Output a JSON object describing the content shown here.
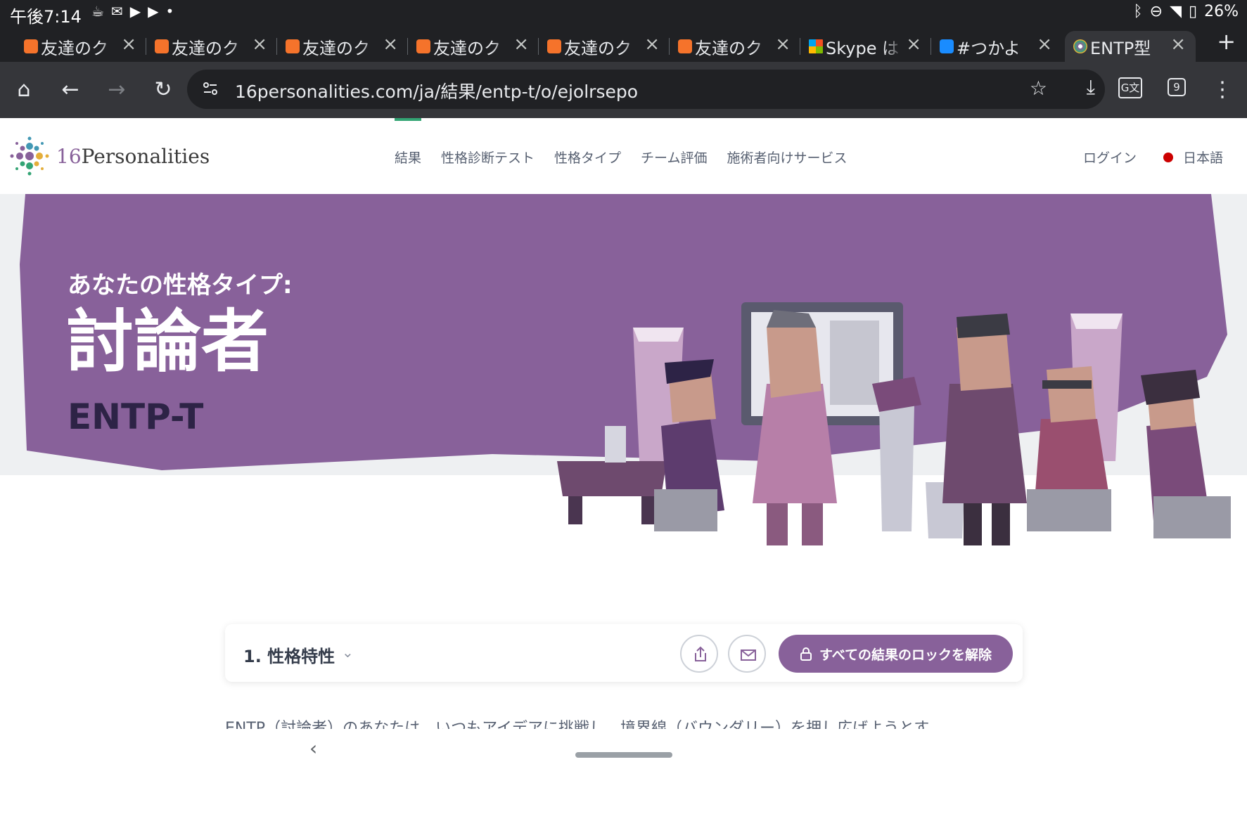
{
  "status_bar": {
    "time": "午後7:14",
    "battery": "26%"
  },
  "tabs": [
    {
      "title": "友達のク",
      "favicon_color": "#f5732b",
      "active": false
    },
    {
      "title": "友達のク",
      "favicon_color": "#f5732b",
      "active": false
    },
    {
      "title": "友達のク",
      "favicon_color": "#f5732b",
      "active": false
    },
    {
      "title": "友達のク",
      "favicon_color": "#f5732b",
      "active": false
    },
    {
      "title": "友達のク",
      "favicon_color": "#f5732b",
      "active": false
    },
    {
      "title": "友達のク",
      "favicon_color": "#f5732b",
      "active": false
    },
    {
      "title": "Skype は",
      "favicon_color": "#00a4ef",
      "active": false
    },
    {
      "title": "#つかよ",
      "favicon_color": "#1a8cff",
      "active": false
    },
    {
      "title": "ENTP型",
      "favicon_color": "#88619a",
      "active": true
    }
  ],
  "toolbar": {
    "url": "16personalities.com/ja/結果/entp-t/o/ejolrsepo",
    "tab_count": "9"
  },
  "site": {
    "logo_number": "16",
    "logo_text": "Personalities",
    "nav": [
      "結果",
      "性格診断テスト",
      "性格タイプ",
      "チーム評価",
      "施術者向けサービス"
    ],
    "login": "ログイン",
    "language": "日本語",
    "colors": {
      "accent": "#88619a",
      "hero_purple": "#88619a",
      "nav_active": "#33a474"
    }
  },
  "hero": {
    "kicker": "あなたの性格タイプ:",
    "title": "討論者",
    "code": "ENTP-T"
  },
  "section_bar": {
    "section": "1. 性格特性",
    "unlock_label": "すべての結果のロックを解除"
  },
  "paragraph_peek": "ENTP（討論者）のあなたは、いつもアイデアに挑戦し、境界線（バウンダリー）を押し広げようとす"
}
